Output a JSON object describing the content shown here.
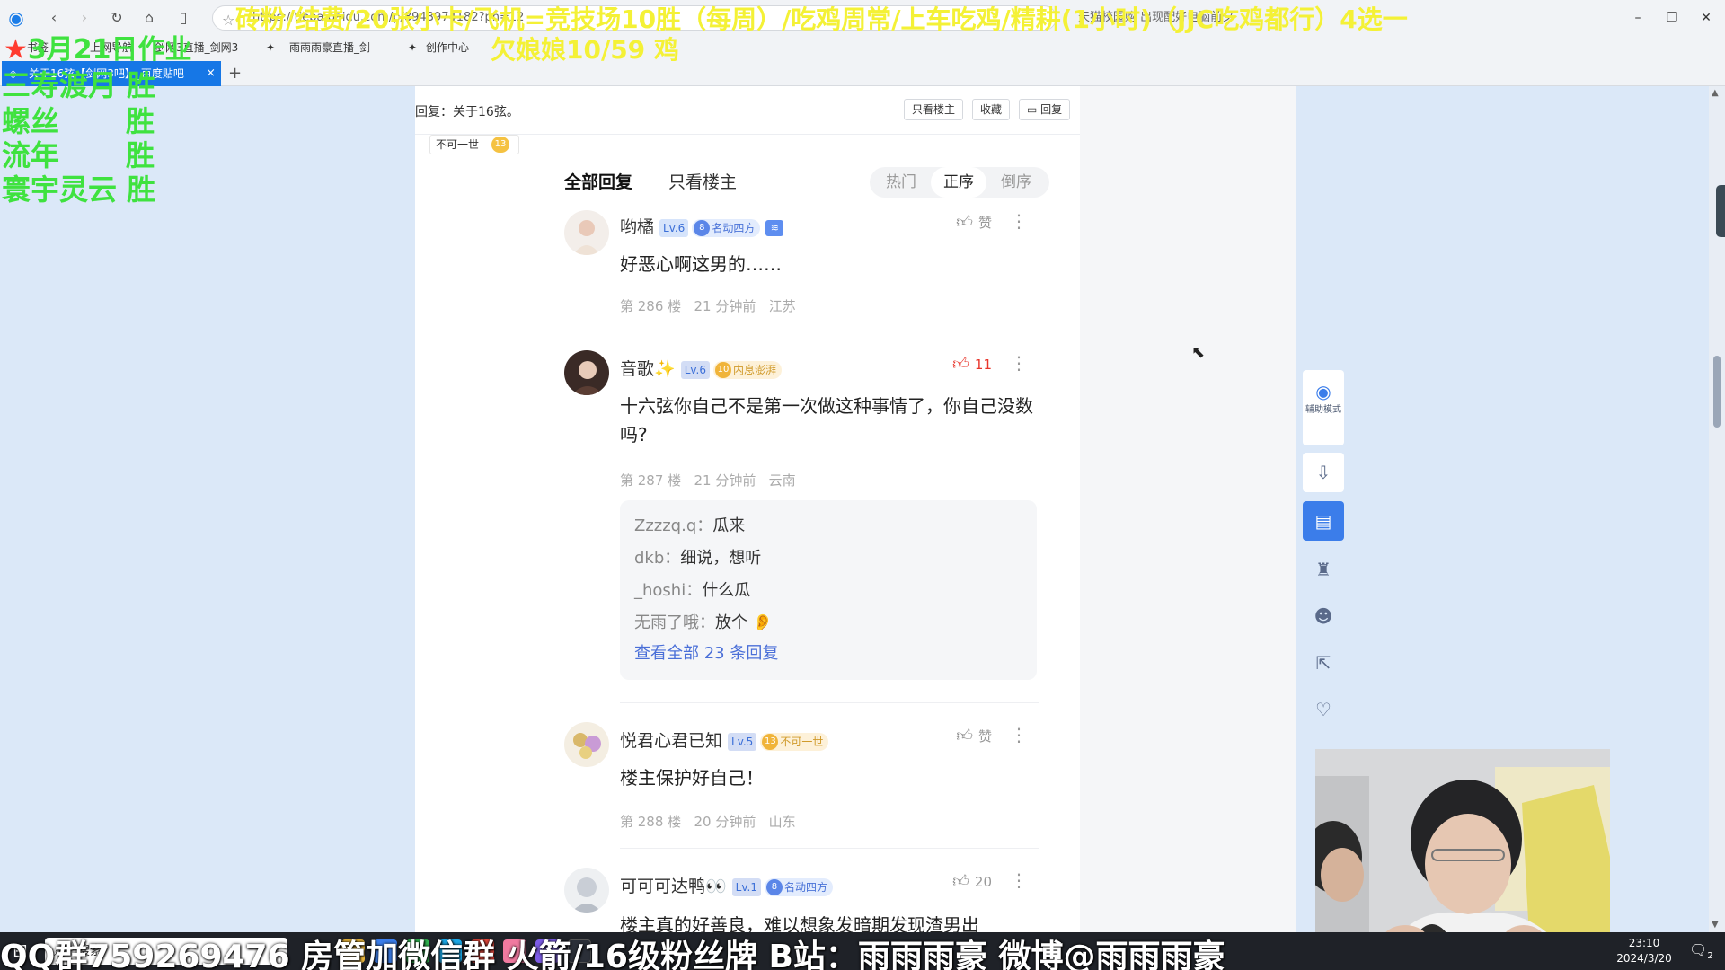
{
  "browser": {
    "url": "https://tieba.baidu.com/p/8943974182?pn=12",
    "right_tools_text": "天猫校园购 出现配好电脑前夕",
    "bookmarks": [
      "书签",
      "上网导航",
      "剑网3直播_剑网3",
      "雨雨雨豪直播_剑",
      "创作中心"
    ],
    "tab_title": "关于16弦【剑网3吧】_百度贴吧",
    "tab_close": "×",
    "tab_new": "+"
  },
  "page": {
    "reply_title": "回复：关于16弦。",
    "buttons": {
      "only_op": "只看楼主",
      "favorite": "收藏",
      "reply": "回复"
    },
    "user_chip": {
      "name": "不可一世",
      "level": "13"
    },
    "sort": {
      "all": "全部回复",
      "only_op": "只看楼主",
      "options": [
        "热门",
        "正序",
        "倒序"
      ],
      "active": "正序"
    },
    "comments": [
      {
        "user": "哟橘",
        "level": "Lv.6",
        "badge": "名动四方",
        "badge_num": "8",
        "text": "好恶心啊这男的……",
        "floor": "第 286 楼",
        "time": "21 分钟前",
        "region": "江苏",
        "likes": "赞"
      },
      {
        "user": "音歌",
        "level": "Lv.6",
        "badge": "内息澎湃",
        "badge_num": "10",
        "text": "十六弦你自己不是第一次做这种事情了，你自己没数吗?",
        "floor": "第 287 楼",
        "time": "21 分钟前",
        "region": "云南",
        "likes": "11",
        "replies": [
          {
            "user": "Zzzzq.q",
            "sep": "：",
            "text": "瓜来"
          },
          {
            "user": "dkb",
            "sep": "：",
            "text": "细说，想听"
          },
          {
            "user": "_hoshi",
            "sep": "：",
            "text": "什么瓜"
          },
          {
            "user": "无雨了哦",
            "sep": "：",
            "text": "放个 👂"
          }
        ],
        "view_all": "查看全部 23 条回复"
      },
      {
        "user": "悦君心君已知",
        "level": "Lv.5",
        "badge": "不可一世",
        "badge_num": "13",
        "text": "楼主保护好自己！",
        "floor": "第 288 楼",
        "time": "20 分钟前",
        "region": "山东",
        "likes": "赞"
      },
      {
        "user": "可可可达鸭👀",
        "level": "Lv.1",
        "badge": "名动四方",
        "badge_num": "8",
        "text": "楼主真的好善良，难以想象发暗期发现渣男出",
        "likes": "20"
      }
    ],
    "side_tools": {
      "assist": "辅助模式"
    }
  },
  "overlay": {
    "top_banner": "砖粉/结费/20张小卡/飞机=竞技场10胜（每周）/吃鸡周常/上车吃鸡/精耕(1小时)（JJC吃鸡都行）4选一",
    "debt": "欠娘娘10/59 鸡",
    "schedule_title": "3月21日作业",
    "schedule": [
      {
        "name": "三寿渡月",
        "result": "胜"
      },
      {
        "name": "螺丝",
        "result": "胜"
      },
      {
        "name": "流年",
        "result": "胜"
      },
      {
        "name": "寰宇灵云",
        "result": "胜"
      }
    ],
    "ticker": "QQ群759269476 房管加微信群 火箭/16级粉丝牌 B站：雨雨雨豪 微博@雨雨雨豪"
  },
  "taskbar": {
    "search": "搜索",
    "time": "23:10",
    "date": "2024/3/20",
    "notifications": "2"
  },
  "colors": {
    "accent": "#1677e6",
    "like_red": "#e8362c",
    "link": "#4a6fd8",
    "overlay_yellow": "#f4f136",
    "overlay_green": "#3fe23f"
  }
}
